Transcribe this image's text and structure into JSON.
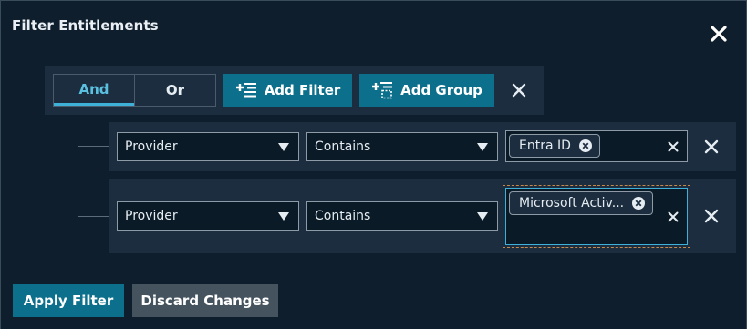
{
  "dialog": {
    "title": "Filter Entitlements",
    "close_icon": "close-icon"
  },
  "group": {
    "operators": [
      {
        "label": "And",
        "selected": true
      },
      {
        "label": "Or",
        "selected": false
      }
    ],
    "add_filter_label": "Add Filter",
    "add_filter_icon": "add-filter-icon",
    "add_group_label": "Add Group",
    "add_group_icon": "add-group-icon",
    "remove_icon": "close-icon"
  },
  "filters": [
    {
      "field": "Provider",
      "operator": "Contains",
      "values": [
        "Entra ID"
      ]
    },
    {
      "field": "Provider",
      "operator": "Contains",
      "values": [
        "Microsoft Activ..."
      ]
    }
  ],
  "footer": {
    "apply_label": "Apply Filter",
    "discard_label": "Discard Changes"
  },
  "colors": {
    "background": "#0e1e2c",
    "panel": "#1b2d3e",
    "accent": "#0c6f8c",
    "active_operator": "#3fb0d8",
    "secondary_button": "#45535f"
  }
}
